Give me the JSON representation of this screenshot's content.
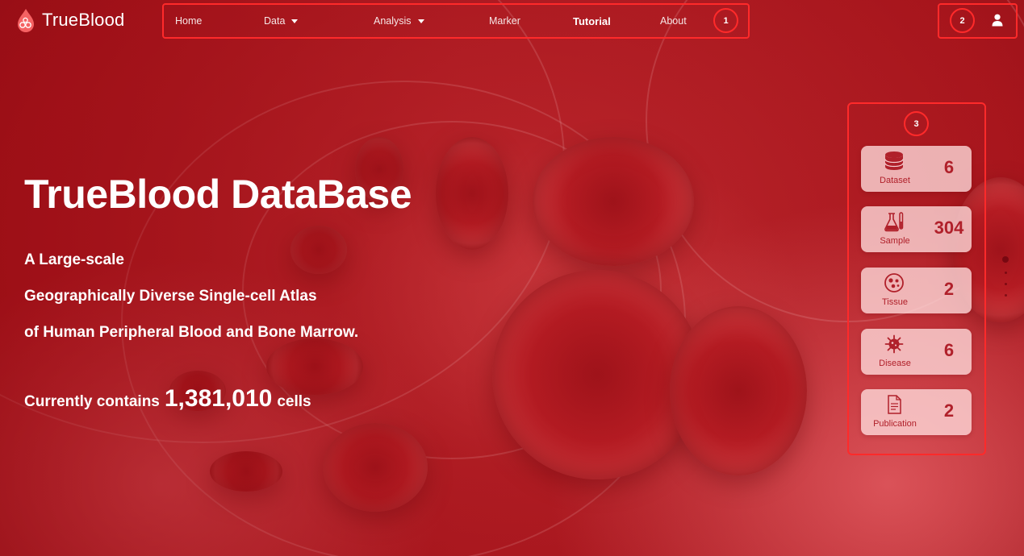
{
  "brand": {
    "name": "TrueBlood"
  },
  "nav": {
    "items": [
      {
        "label": "Home",
        "has_caret": false
      },
      {
        "label": "Data",
        "has_caret": true
      },
      {
        "label": "Analysis",
        "has_caret": true
      },
      {
        "label": "Marker",
        "has_caret": false
      },
      {
        "label": "Tutorial",
        "has_caret": false,
        "active": true
      },
      {
        "label": "About",
        "has_caret": false
      }
    ],
    "annotation": "1"
  },
  "account": {
    "annotation": "2",
    "icon": "user-icon"
  },
  "hero": {
    "title": "TrueBlood DataBase",
    "lines": [
      "A Large-scale",
      "Geographically Diverse Single-cell Atlas",
      "of Human Peripheral Blood and Bone Marrow."
    ],
    "count_prefix": "Currently contains",
    "count_value": "1,381,010",
    "count_suffix": "cells"
  },
  "stats": {
    "annotation": "3",
    "cards": [
      {
        "label": "Dataset",
        "value": "6",
        "icon": "database-icon"
      },
      {
        "label": "Sample",
        "value": "304",
        "icon": "flask-icon"
      },
      {
        "label": "Tissue",
        "value": "2",
        "icon": "tissue-icon"
      },
      {
        "label": "Disease",
        "value": "6",
        "icon": "virus-icon"
      },
      {
        "label": "Publication",
        "value": "2",
        "icon": "document-icon"
      }
    ]
  },
  "colors": {
    "primary_red": "#b0202a",
    "annotation_red": "#ff2a2a"
  }
}
